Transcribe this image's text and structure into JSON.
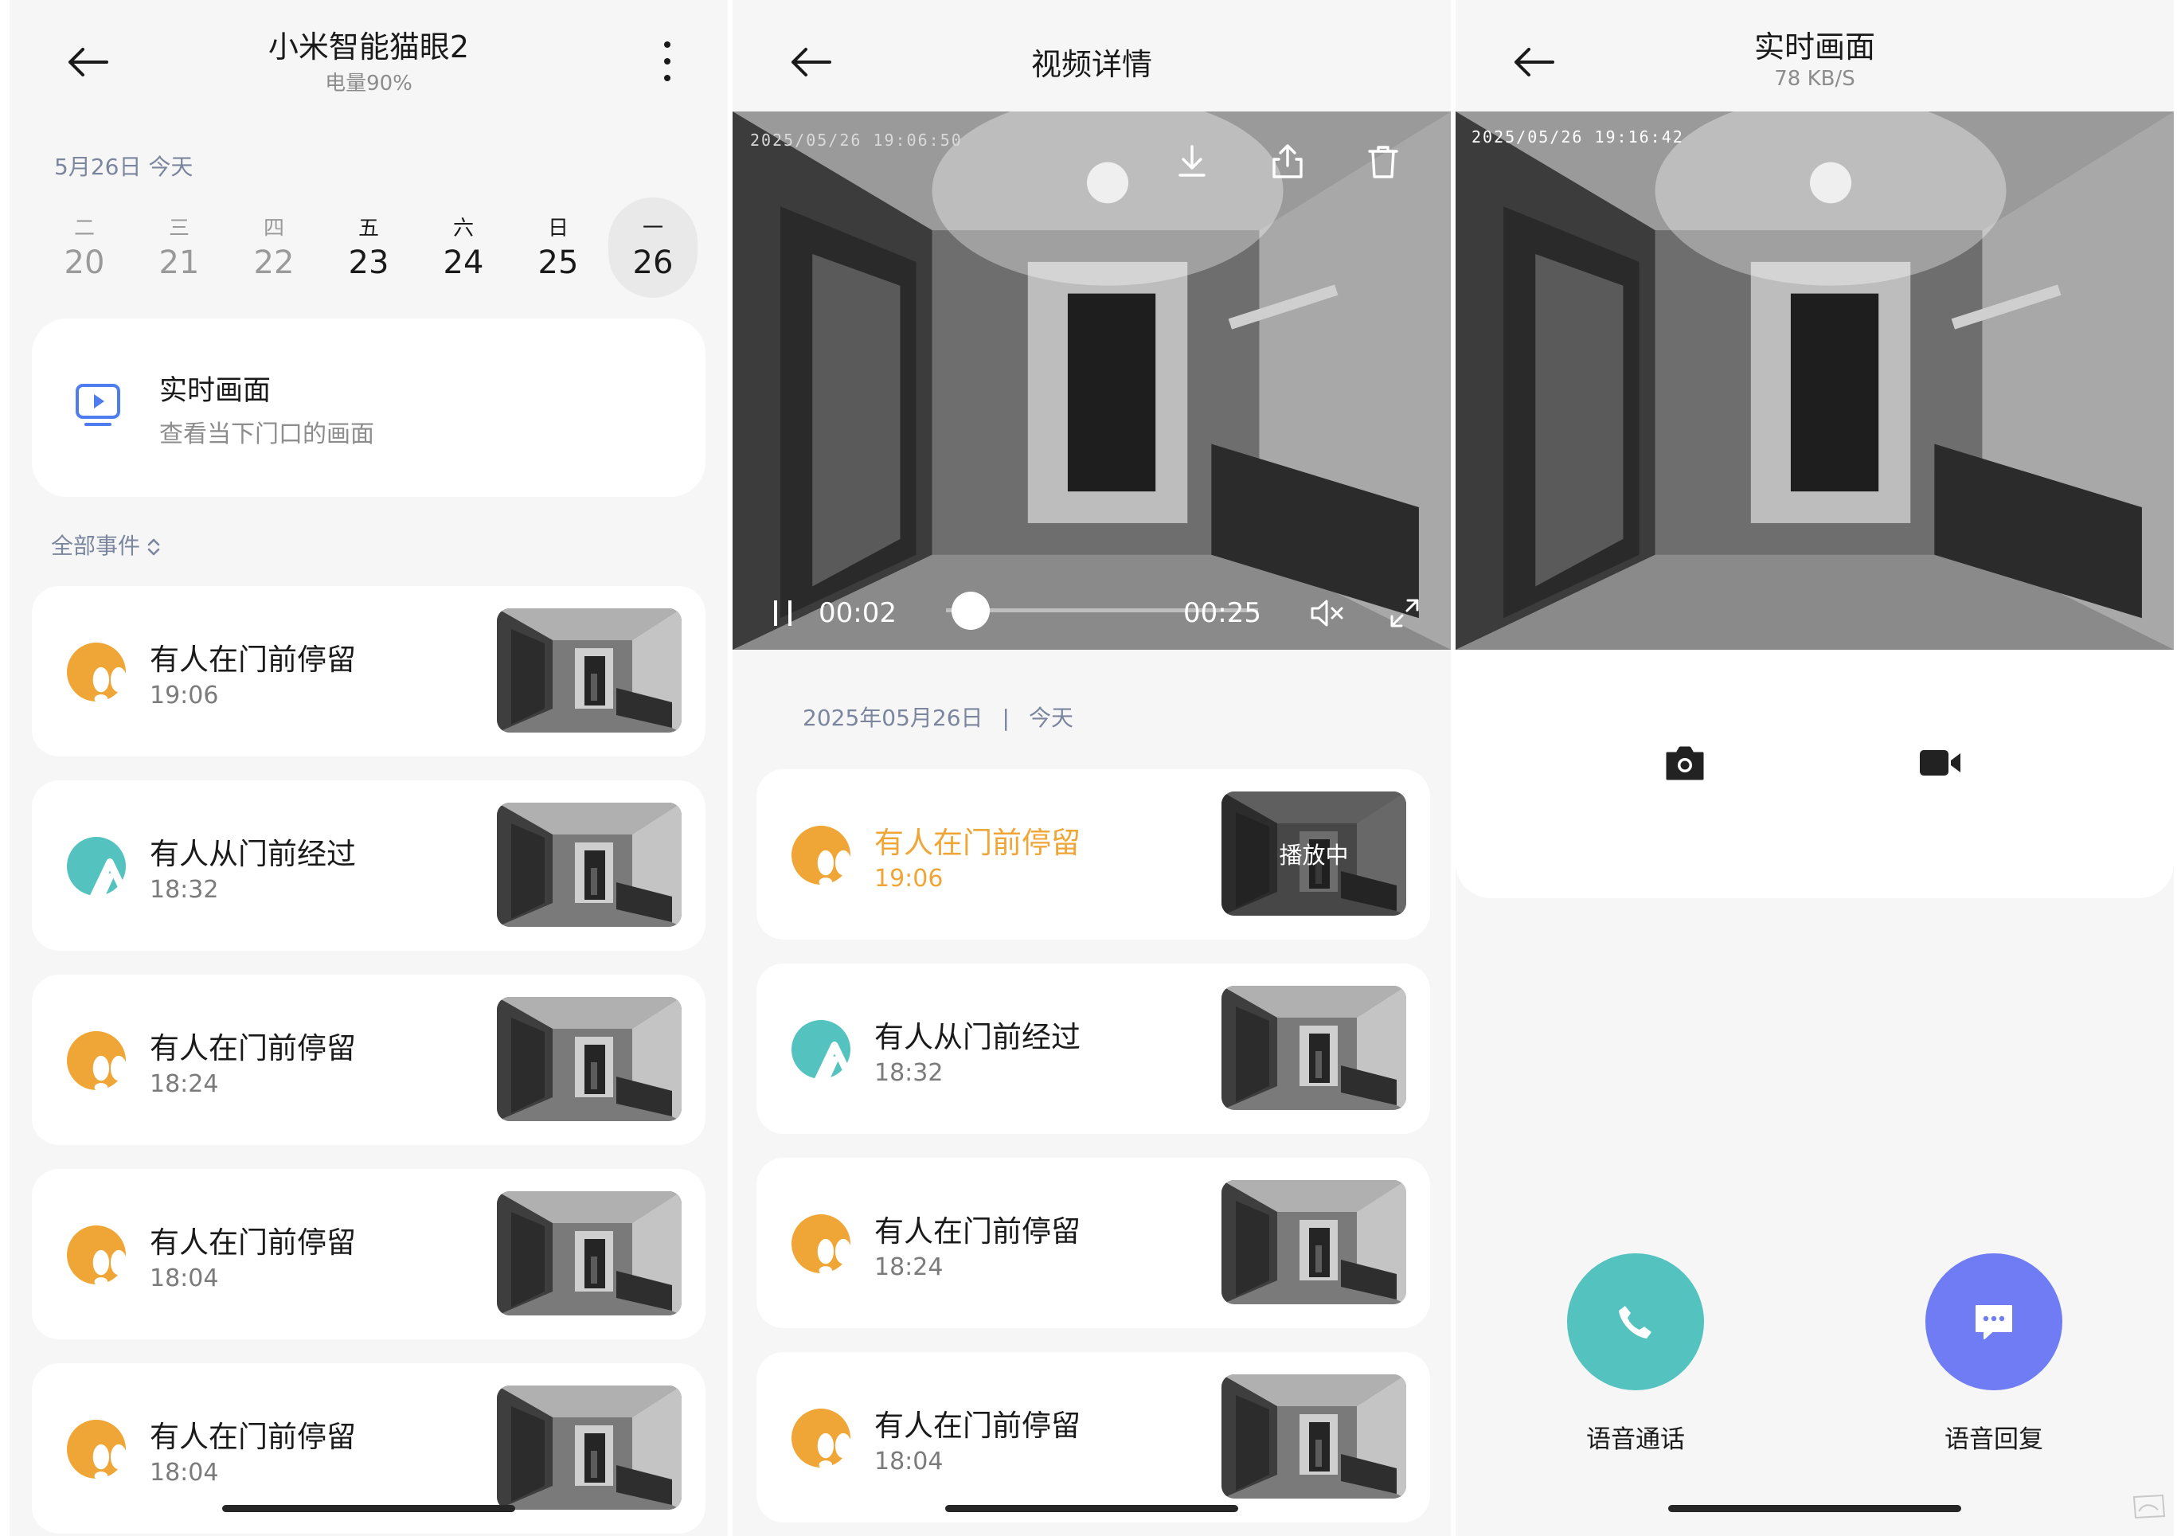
{
  "screen1": {
    "header": {
      "title": "小米智能猫眼2",
      "subtitle": "电量90%"
    },
    "date_label": "5月26日 今天",
    "week": [
      {
        "wd": "二",
        "dn": "20"
      },
      {
        "wd": "三",
        "dn": "21"
      },
      {
        "wd": "四",
        "dn": "22"
      },
      {
        "wd": "五",
        "dn": "23"
      },
      {
        "wd": "六",
        "dn": "24"
      },
      {
        "wd": "日",
        "dn": "25"
      },
      {
        "wd": "一",
        "dn": "26"
      }
    ],
    "live_card": {
      "title": "实时画面",
      "subtitle": "查看当下门口的画面",
      "icon": "tv-play-icon"
    },
    "filter_label": "全部事件",
    "events": [
      {
        "title": "有人在门前停留",
        "time": "19:06",
        "icon": "footprints-icon"
      },
      {
        "title": "有人从门前经过",
        "time": "18:32",
        "icon": "walking-icon"
      },
      {
        "title": "有人在门前停留",
        "time": "18:24",
        "icon": "footprints-icon"
      },
      {
        "title": "有人在门前停留",
        "time": "18:04",
        "icon": "footprints-icon"
      },
      {
        "title": "有人在门前停留",
        "time": "18:04",
        "icon": "footprints-icon"
      }
    ]
  },
  "screen2": {
    "header": {
      "title": "视频详情"
    },
    "video": {
      "timestamp": "2025/05/26 19:06:50",
      "current": "00:02",
      "duration": "00:25",
      "progress": 0.08
    },
    "date_row": {
      "date": "2025年05月26日",
      "sep": "|",
      "day": "今天"
    },
    "playing_label": "播放中",
    "events": [
      {
        "title": "有人在门前停留",
        "time": "19:06"
      },
      {
        "title": "有人从门前经过",
        "time": "18:32"
      },
      {
        "title": "有人在门前停留",
        "time": "18:24"
      },
      {
        "title": "有人在门前停留",
        "time": "18:04"
      }
    ]
  },
  "screen3": {
    "header": {
      "title": "实时画面",
      "subtitle": "78 KB/S"
    },
    "timestamp": "2025/05/26  19:16:42",
    "voice_call": "语音通话",
    "voice_reply": "语音回复"
  },
  "colors": {
    "orange": "#efa636",
    "teal": "#54c3c0",
    "purple": "#6f7cf3",
    "label_blue": "#7b869e"
  }
}
